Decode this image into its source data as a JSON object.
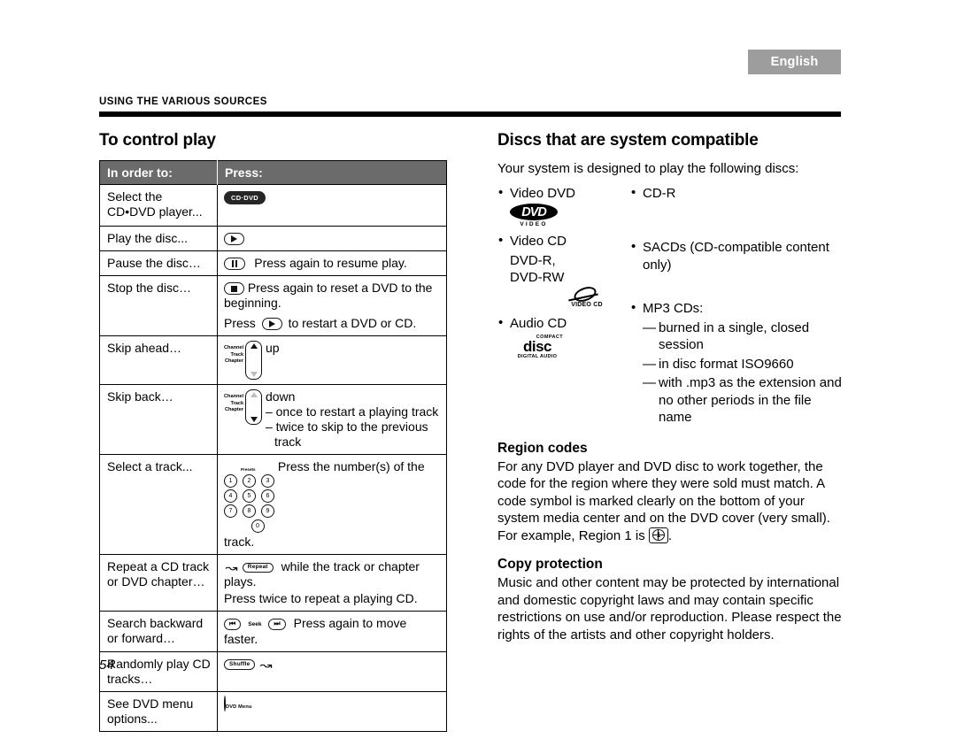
{
  "language_tab": "English",
  "running_head": "Using the various sources",
  "page_number": "54",
  "left_column": {
    "heading": "To control play",
    "table": {
      "headers": [
        "In order to:",
        "Press:"
      ],
      "rows": [
        {
          "action": "Select the\nCD•DVD player...",
          "key": "cd-dvd",
          "key_label": "CD·DVD",
          "note": ""
        },
        {
          "action": "Play the disc...",
          "key": "play",
          "note": ""
        },
        {
          "action": "Pause the disc…",
          "key": "pause",
          "note": "Press again to resume play."
        },
        {
          "action": "Stop the disc…",
          "key": "stop",
          "note": "Press again to reset a DVD to the beginning.",
          "note2_pre": "Press",
          "note2_post": "to restart a DVD or CD."
        },
        {
          "action": "Skip ahead…",
          "key": "rocker-up",
          "rocker_labels": [
            "Channel",
            "Track",
            "Chapter"
          ],
          "note": "up"
        },
        {
          "action": "Skip back…",
          "key": "rocker-down",
          "rocker_labels": [
            "Channel",
            "Track",
            "Chapter"
          ],
          "note": "down",
          "sub_notes": [
            "– once to restart a playing track",
            "– twice to skip to the previous",
            "track"
          ]
        },
        {
          "action": "Select a track...",
          "key": "keypad",
          "keypad_label": "Presets",
          "keypad_keys": [
            "1",
            "2",
            "3",
            "4",
            "5",
            "6",
            "7",
            "8",
            "9",
            "0"
          ],
          "note": "Press the number(s) of the track."
        },
        {
          "action": "Repeat a CD track\nor DVD chapter…",
          "key": "repeat",
          "key_label": "Repeat",
          "note": "while the track or chapter plays.",
          "note2": "Press twice to repeat a playing CD."
        },
        {
          "action": "Search backward\nor forward…",
          "key": "seek",
          "key_label": "Seek",
          "note": "Press again to move faster."
        },
        {
          "action": "Randomly play CD\ntracks…",
          "key": "shuffle",
          "key_label": "Shuffle",
          "note": ""
        },
        {
          "action": "See DVD menu\noptions...",
          "key": "dvd-menu",
          "key_label": "DVD Menu",
          "note": ""
        }
      ]
    }
  },
  "right_column": {
    "heading": "Discs that are system compatible",
    "intro": "Your system is designed to play the following discs:",
    "disc_list_left": [
      "Video DVD",
      "Video CD"
    ],
    "disc_list_left_cont": [
      "DVD-R,",
      "DVD-RW"
    ],
    "disc_list_left_2": [
      "Audio CD"
    ],
    "disc_list_right": [
      "CD-R",
      "SACDs (CD-compatible content only)",
      "MP3 CDs:"
    ],
    "mp3_details": [
      "burned in a single, closed session",
      "in disc format ISO9660",
      "with .mp3 as the extension and no other periods in the file name"
    ],
    "logos": {
      "dvd": {
        "mark": "DVD",
        "sub": "VIDEO"
      },
      "video_cd": {
        "text": "VIDEO CD"
      },
      "audio_cd": {
        "top": "COMPACT",
        "mid": "disc",
        "bottom": "DIGITAL AUDIO"
      }
    },
    "region_codes": {
      "heading": "Region codes",
      "body_pre": "For any DVD player and DVD disc to work together, the code for the region where they were sold must match. A code symbol is marked clearly on the bottom of your system media center and on the DVD cover (very small). For example, Region 1 is",
      "region_number": "1",
      "body_post": "."
    },
    "copy_protection": {
      "heading": "Copy protection",
      "body": "Music and other content may be protected by international and domestic copyright laws and may contain specific restrictions on use and/or reproduction. Please respect the rights of the artists and other copyright holders."
    }
  },
  "colors": {
    "tab_bg": "#9d9d9d",
    "table_header_bg": "#6b6b6b",
    "rule": "#000000"
  }
}
